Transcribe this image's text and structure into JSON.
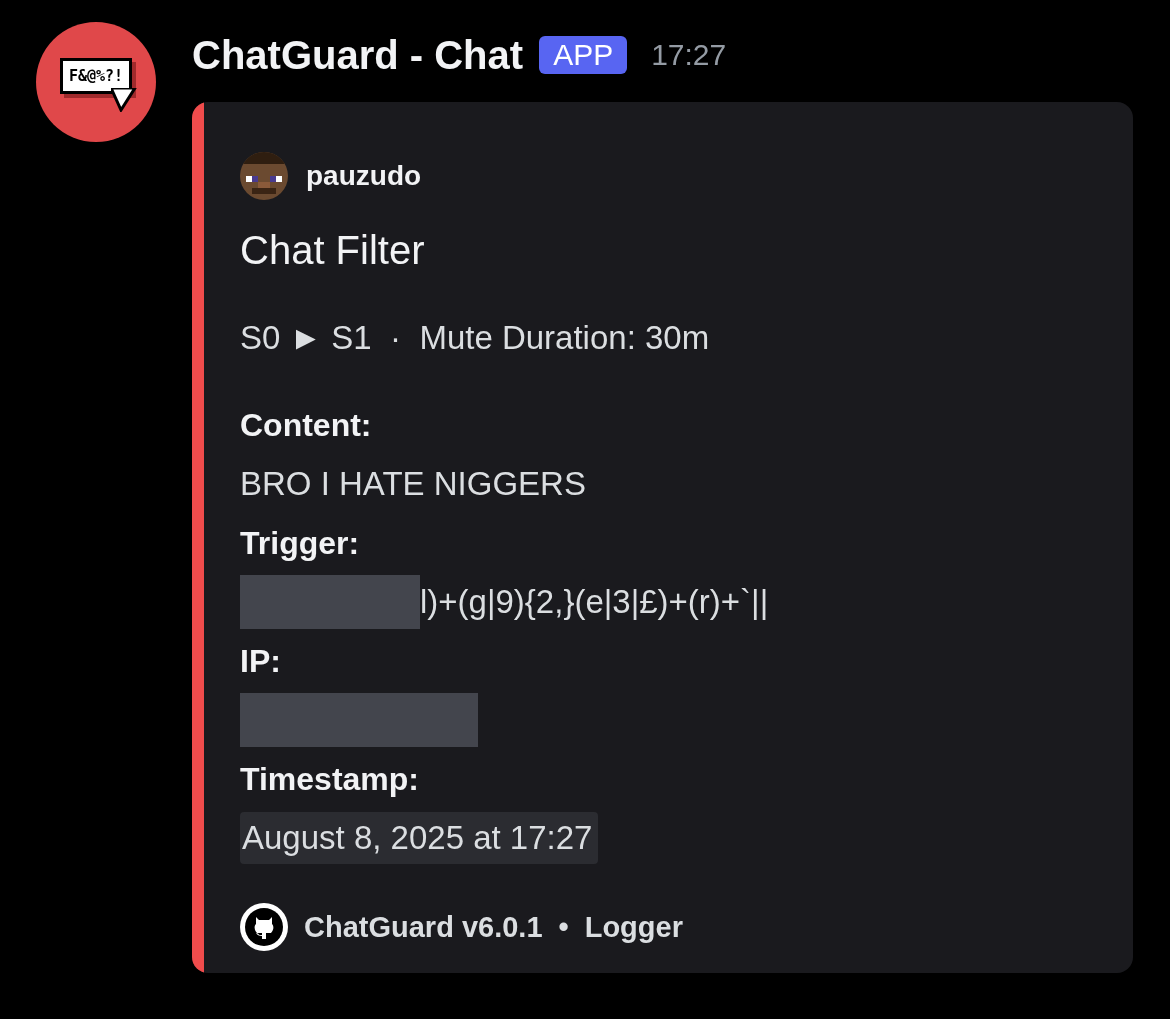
{
  "message": {
    "avatar_label": "F&@%?!",
    "author": "ChatGuard - Chat",
    "badge": "APP",
    "time": "17:27"
  },
  "embed": {
    "author": "pauzudo",
    "title": "Chat Filter",
    "description": "S0 ► S1  ·  Mute Duration: 30m",
    "fields": [
      {
        "name": "Content:",
        "kind": "text",
        "value": "BRO I HATE NIGGERS"
      },
      {
        "name": "Trigger:",
        "kind": "spoilered",
        "value": "l)+(g|9){2,}(e|3|£)+(r)+`||"
      },
      {
        "name": "IP:",
        "kind": "spoiler"
      },
      {
        "name": "Timestamp:",
        "kind": "timestamp",
        "value": "August 8, 2025 at 17:27"
      }
    ],
    "footer": {
      "text": "ChatGuard v6.0.1",
      "separator": "•",
      "detail": "Logger"
    }
  }
}
